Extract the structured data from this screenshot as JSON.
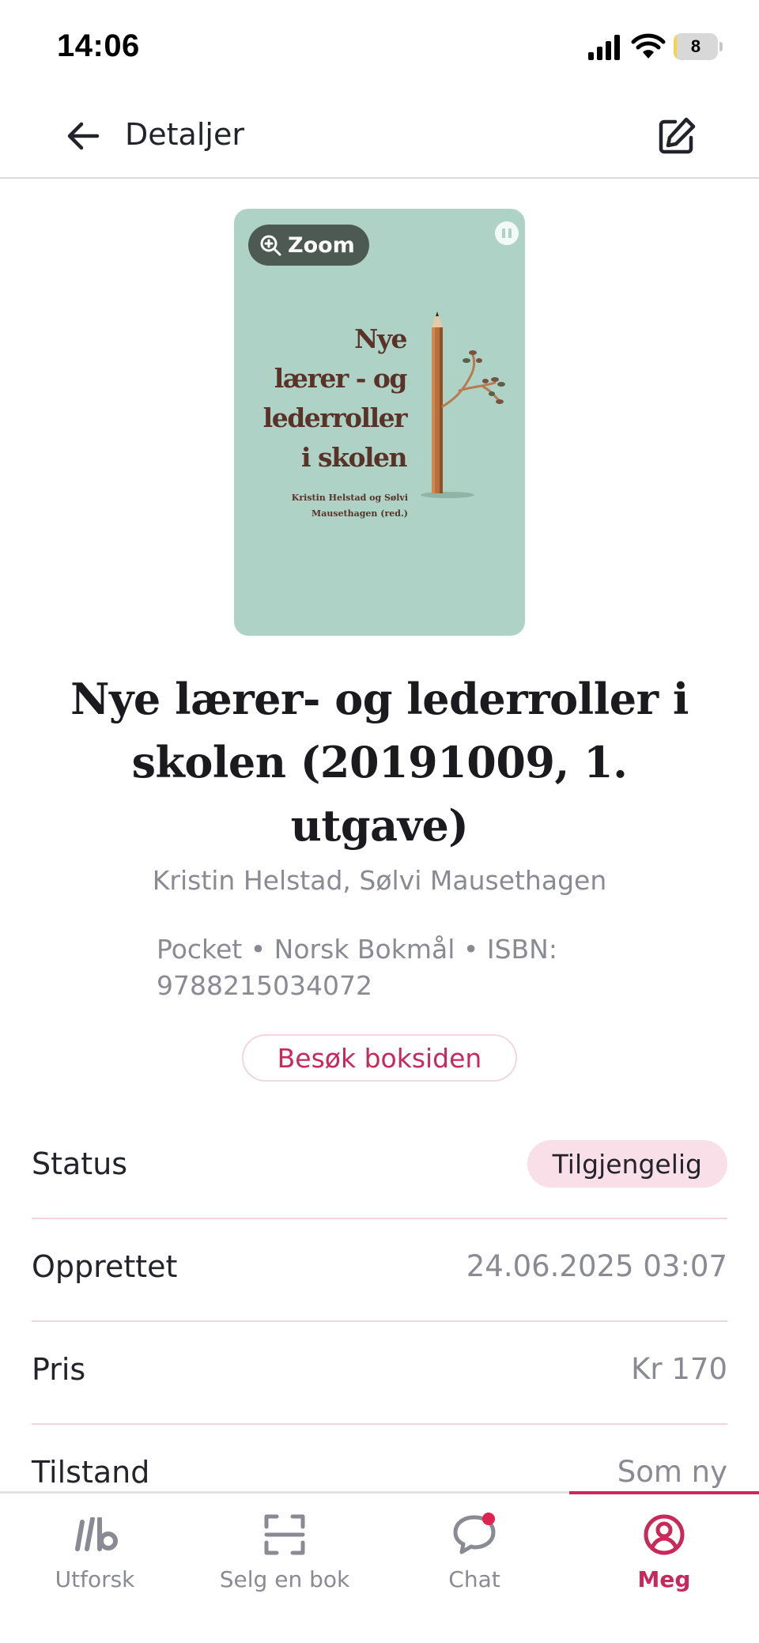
{
  "status_bar": {
    "time": "14:06",
    "battery_level": "8",
    "battery_fraction": 0.08,
    "icons": [
      "cellular-signal-icon",
      "wifi-icon",
      "battery-icon"
    ]
  },
  "header": {
    "title": "Detaljer",
    "back_icon": "arrow-left-icon",
    "edit_icon": "edit-pencil-icon"
  },
  "cover": {
    "zoom_label": "Zoom",
    "title_lines": [
      "Nye",
      "lærer - og",
      "lederroller",
      "i skolen"
    ],
    "authors_lines": [
      "Kristin Helstad og Sølvi",
      "Mausethagen (red.)"
    ],
    "background": "#aed3c6"
  },
  "book": {
    "title": "Nye lærer- og lederroller i skolen (20191009, 1. utgave)",
    "authors": "Kristin Helstad, Sølvi Mausethagen",
    "meta": "Pocket • Norsk Bokmål • ISBN: 9788215034072",
    "visit_button": "Besøk boksiden"
  },
  "details": [
    {
      "label": "Status",
      "value": "Tilgjengelig",
      "type": "pill"
    },
    {
      "label": "Opprettet",
      "value": "24.06.2025 03:07",
      "type": "text"
    },
    {
      "label": "Pris",
      "value": "Kr 170",
      "type": "text"
    },
    {
      "label": "Tilstand",
      "value": "Som ny",
      "type": "text"
    }
  ],
  "bottom_nav": [
    {
      "label": "Utforsk",
      "icon": "explore-logo-icon",
      "active": false
    },
    {
      "label": "Selg en bok",
      "icon": "scan-icon",
      "active": false
    },
    {
      "label": "Chat",
      "icon": "chat-bubble-icon",
      "active": false,
      "badge": true
    },
    {
      "label": "Meg",
      "icon": "profile-icon",
      "active": true
    }
  ],
  "colors": {
    "accent": "#c8285c",
    "text": "#23232b",
    "muted": "#8a8a94",
    "pill_bg": "#f9e0e8",
    "divider": "#f4d4dd"
  }
}
